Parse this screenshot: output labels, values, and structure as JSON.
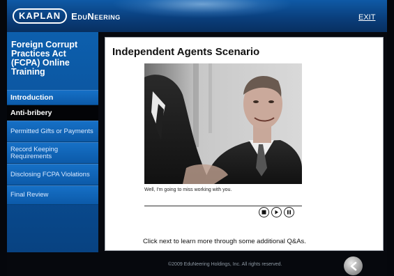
{
  "header": {
    "logo_kaplan": "KAPLAN",
    "logo_edu": "EduNeering",
    "exit_label": "EXIT"
  },
  "sidebar": {
    "course_title": "Foreign Corrupt Practices Act (FCPA) Online Training",
    "items": [
      {
        "label": "Introduction",
        "active": false
      },
      {
        "label": "Anti-bribery",
        "active": true
      },
      {
        "label": "Permitted Gifts or Payments",
        "active": false
      },
      {
        "label": "Record Keeping Requirements",
        "active": false
      },
      {
        "label": "Disclosing FCPA Violations",
        "active": false
      },
      {
        "label": "Final Review",
        "active": false
      }
    ]
  },
  "content": {
    "title": "Independent Agents Scenario",
    "caption": "Well, I'm going to miss working with you.",
    "controls": [
      "stop-icon",
      "play-icon",
      "pause-icon"
    ],
    "footer_note": "Click next to learn more through some additional Q&As."
  },
  "footer": {
    "copyright": "©2009 EduNeering Holdings, Inc. All rights reserved.",
    "back_icon": "left-arrow-icon"
  },
  "colors": {
    "header_blue": "#0a3f7d",
    "sidebar_blue": "#0c5aa9",
    "active_nav": "#030407",
    "background": "#05070c"
  }
}
